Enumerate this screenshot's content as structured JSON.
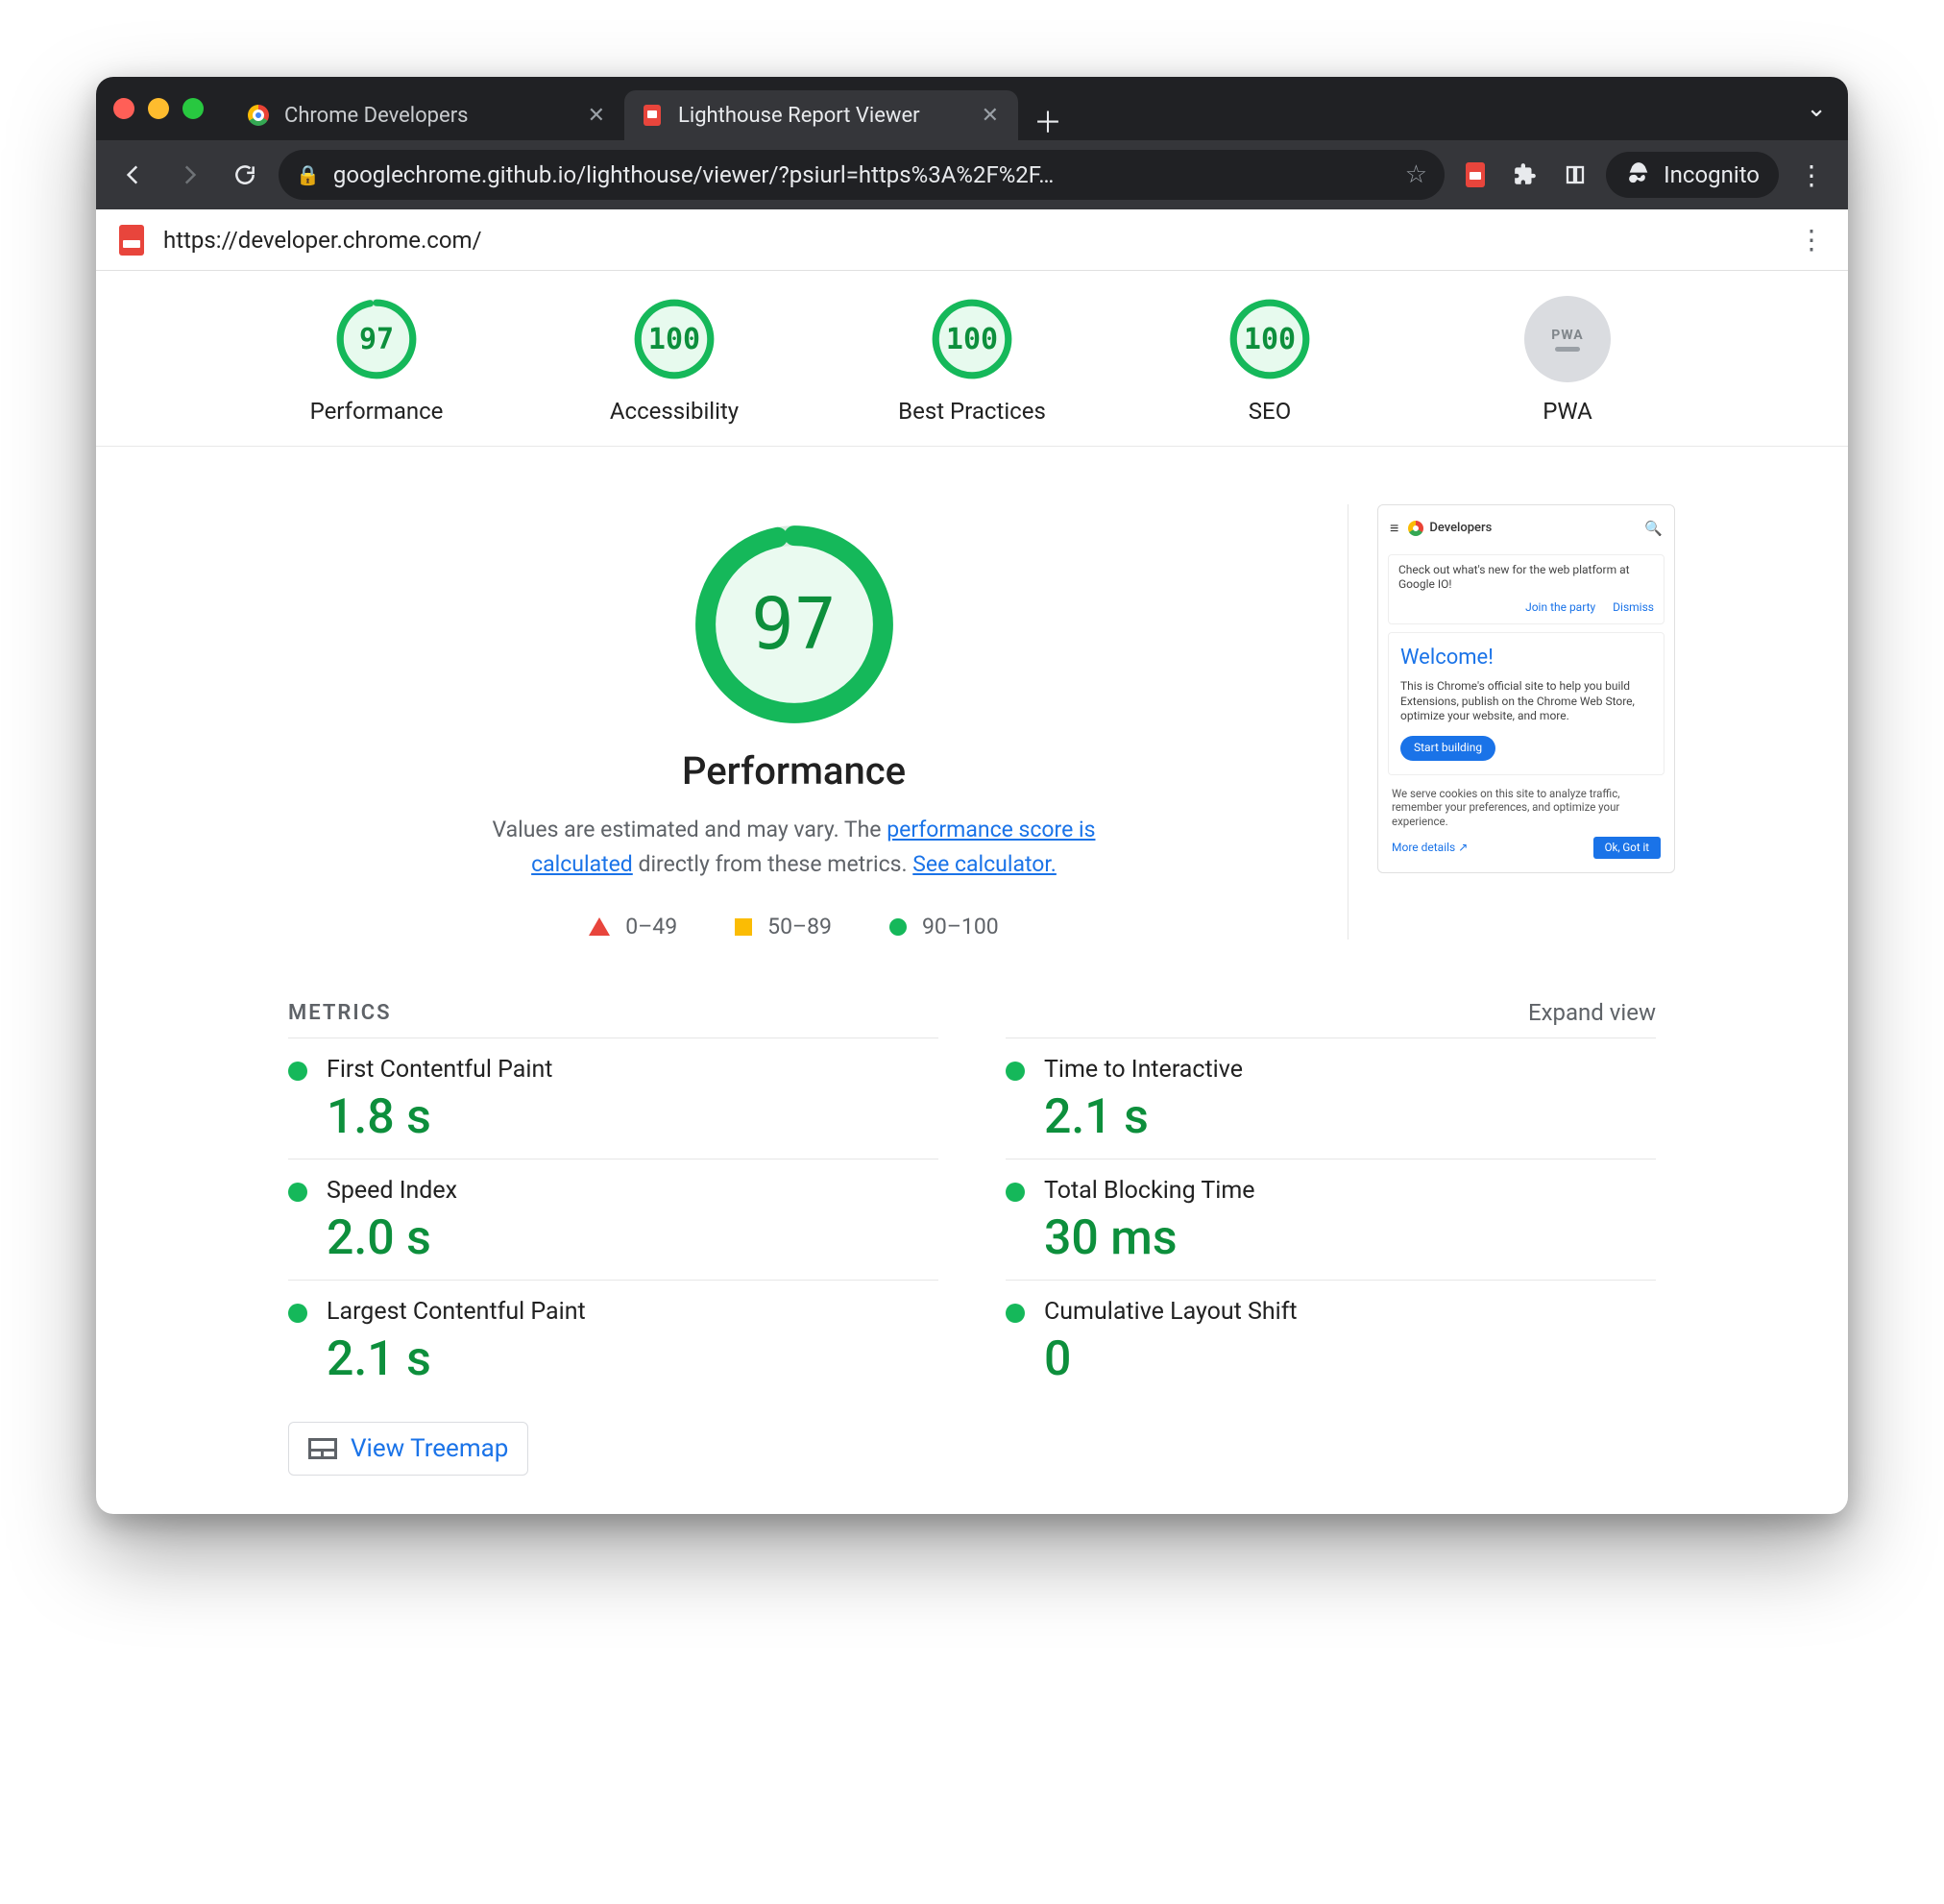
{
  "browser": {
    "tabs": [
      {
        "title": "Chrome Developers",
        "active": false
      },
      {
        "title": "Lighthouse Report Viewer",
        "active": true
      }
    ],
    "omnibox_url": "googlechrome.github.io/lighthouse/viewer/?psiurl=https%3A%2F%2F…",
    "incognito_label": "Incognito"
  },
  "page": {
    "tested_url": "https://developer.chrome.com/"
  },
  "summary": {
    "items": [
      {
        "key": "performance",
        "label": "Performance",
        "score": 97
      },
      {
        "key": "accessibility",
        "label": "Accessibility",
        "score": 100
      },
      {
        "key": "best-practices",
        "label": "Best Practices",
        "score": 100
      },
      {
        "key": "seo",
        "label": "SEO",
        "score": 100
      },
      {
        "key": "pwa",
        "label": "PWA",
        "score": null
      }
    ]
  },
  "performance": {
    "score": 97,
    "title": "Performance",
    "desc_pre": "Values are estimated and may vary. The ",
    "link1": "performance score is calculated",
    "desc_mid": " directly from these metrics. ",
    "link2": "See calculator.",
    "legend": {
      "low": "0–49",
      "mid": "50–89",
      "high": "90–100"
    }
  },
  "thumbnail": {
    "brand": "Developers",
    "banner_text": "Check out what's new for the web platform at Google IO!",
    "banner_link1": "Join the party",
    "banner_link2": "Dismiss",
    "welcome_title": "Welcome!",
    "welcome_body": "This is Chrome's official site to help you build Extensions, publish on the Chrome Web Store, optimize your website, and more.",
    "welcome_btn": "Start building",
    "cookie_text": "We serve cookies on this site to analyze traffic, remember your preferences, and optimize your experience.",
    "cookie_more": "More details",
    "cookie_ok": "Ok, Got it"
  },
  "metrics": {
    "heading": "METRICS",
    "expand": "Expand view",
    "items": [
      {
        "name": "First Contentful Paint",
        "value": "1.8 s"
      },
      {
        "name": "Time to Interactive",
        "value": "2.1 s"
      },
      {
        "name": "Speed Index",
        "value": "2.0 s"
      },
      {
        "name": "Total Blocking Time",
        "value": "30 ms"
      },
      {
        "name": "Largest Contentful Paint",
        "value": "2.1 s"
      },
      {
        "name": "Cumulative Layout Shift",
        "value": "0"
      }
    ],
    "treemap_label": "View Treemap"
  },
  "chart_data": {
    "type": "gauges_and_metrics",
    "category_scores": {
      "Performance": 97,
      "Accessibility": 100,
      "Best Practices": 100,
      "SEO": 100,
      "PWA": null
    },
    "score_scale": {
      "fail": [
        0,
        49
      ],
      "average": [
        50,
        89
      ],
      "pass": [
        90,
        100
      ]
    },
    "performance_metrics": {
      "First Contentful Paint": "1.8 s",
      "Time to Interactive": "2.1 s",
      "Speed Index": "2.0 s",
      "Total Blocking Time": "30 ms",
      "Largest Contentful Paint": "2.1 s",
      "Cumulative Layout Shift": "0"
    }
  }
}
